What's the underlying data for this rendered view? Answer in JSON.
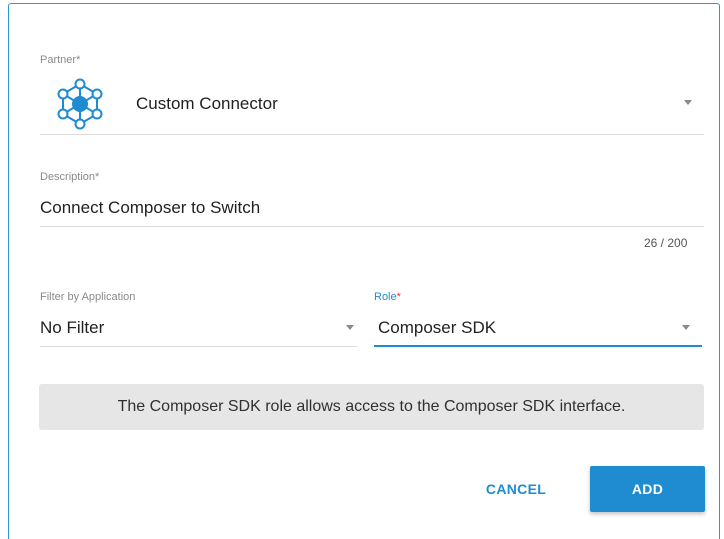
{
  "partner": {
    "label": "Partner",
    "required_mark": "*",
    "icon": "custom-connector-icon",
    "value": "Custom Connector"
  },
  "description": {
    "label": "Description",
    "required_mark": "*",
    "value": "Connect Composer to Switch",
    "counter": "26 / 200"
  },
  "filter": {
    "label": "Filter by Application",
    "value": "No Filter"
  },
  "role": {
    "label": "Role",
    "required_mark": "*",
    "value": "Composer SDK"
  },
  "info_text": "The Composer SDK role allows access to the Composer SDK interface.",
  "buttons": {
    "cancel": "CANCEL",
    "add": "ADD"
  },
  "colors": {
    "accent": "#1f8bd0",
    "required": "#e53935"
  }
}
